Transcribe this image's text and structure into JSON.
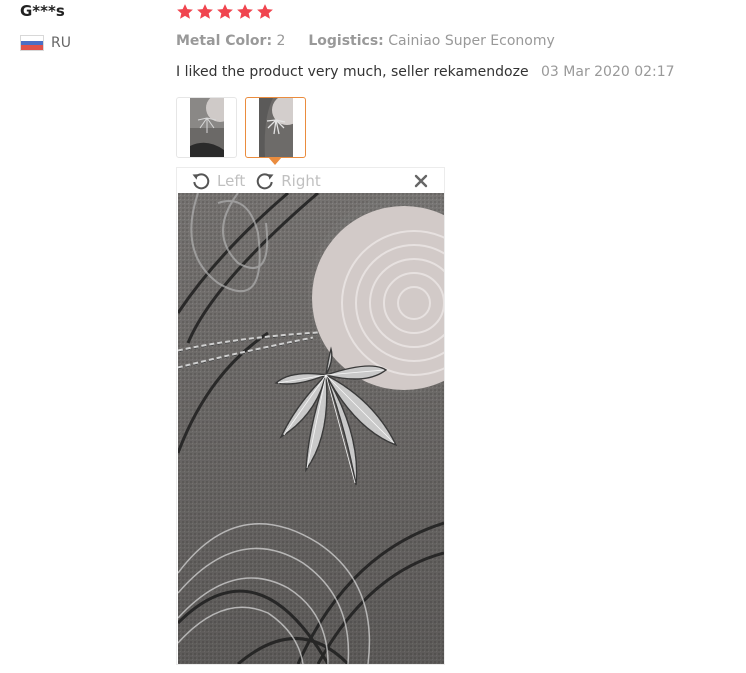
{
  "review": {
    "user_name": "G***s",
    "country_code": "RU",
    "rating": 5,
    "metal_color_label": "Metal Color:",
    "metal_color_value": "2",
    "logistics_label": "Logistics:",
    "logistics_value": "Cainiao Super Economy",
    "text": "I liked the product very much, seller rekamendoze",
    "date": "03 Mar 2020 02:17"
  },
  "viewer": {
    "rotate_left_label": "Left",
    "rotate_right_label": "Right"
  },
  "colors": {
    "star": "#f0454f",
    "accent_orange": "#ea8c3e",
    "muted_text": "#999999"
  },
  "icons": [
    "star-icon",
    "flag-ru-icon",
    "rotate-left-icon",
    "rotate-right-icon",
    "close-icon"
  ]
}
